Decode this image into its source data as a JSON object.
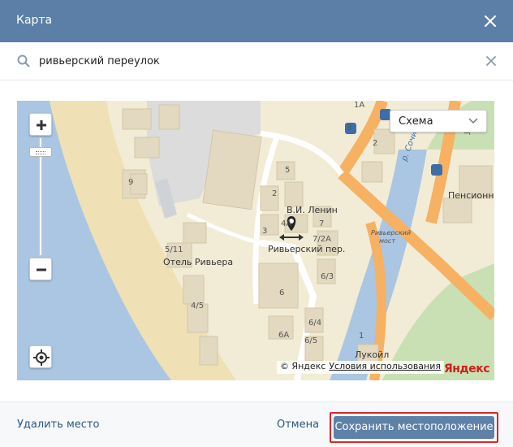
{
  "dialog": {
    "title": "Карта",
    "close_icon": "close-icon"
  },
  "search": {
    "value": "ривьерский переулок",
    "icon": "search-icon",
    "clear_icon": "clear-icon"
  },
  "map": {
    "scheme_label": "Схема",
    "labels": {
      "b1a": "1А",
      "b3": "3",
      "b2": "2",
      "b9": "9",
      "b5": "5",
      "b2b": "2",
      "b4a": "4А",
      "b3b": "3",
      "b7": "7",
      "b72a": "7/2А",
      "b511": "5/11",
      "b6": "6",
      "b63": "6/3",
      "b45": "4/5",
      "b64": "6/4",
      "b65": "6/5",
      "b6a": "6А",
      "b1": "1"
    },
    "places": {
      "lenin": "В.И. Ленин",
      "hotel": "Отель Ривьера",
      "street": "Ривьерский пер.",
      "pensions": "Пенсионны",
      "lukoil": "Лукойл",
      "river": "р. Сочи",
      "bridge_line1": "Ривьерский",
      "bridge_line2": "мост",
      "ul": "ул."
    },
    "copyright_text": "© Яндекс",
    "terms_link": "Условия использования",
    "logo": "Яндекс",
    "colors": {
      "land": "#f2ecd6",
      "water": "#aac6e2",
      "road_major": "#f6b162",
      "building": "#e3d9c0",
      "park": "#c9e0b4"
    }
  },
  "footer": {
    "remove_label": "Удалить место",
    "cancel_label": "Отмена",
    "save_label": "Сохранить местоположение",
    "highlight_color": "#d9262a"
  }
}
